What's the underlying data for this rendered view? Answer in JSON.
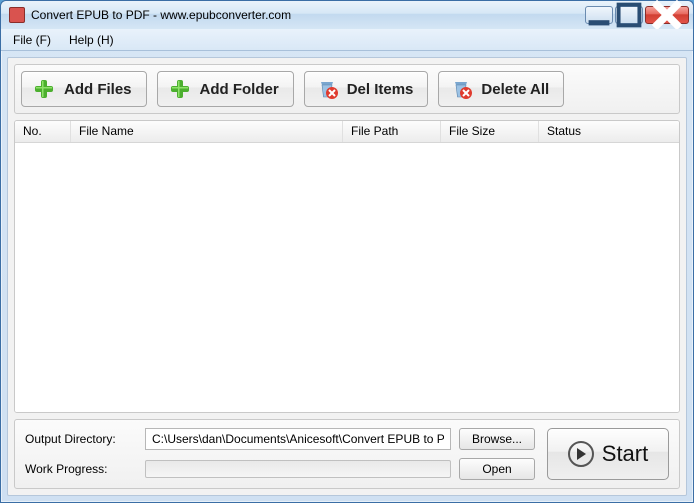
{
  "window": {
    "title": "Convert EPUB to PDF - www.epubconverter.com"
  },
  "menu": {
    "file": "File (F)",
    "help": "Help (H)"
  },
  "toolbar": {
    "add_files": "Add Files",
    "add_folder": "Add Folder",
    "del_items": "Del Items",
    "delete_all": "Delete All"
  },
  "columns": {
    "no": "No.",
    "file_name": "File Name",
    "file_path": "File Path",
    "file_size": "File Size",
    "status": "Status"
  },
  "rows": [],
  "output": {
    "label": "Output Directory:",
    "path": "C:\\Users\\dan\\Documents\\Anicesoft\\Convert EPUB to P",
    "browse": "Browse...",
    "open": "Open"
  },
  "progress": {
    "label": "Work Progress:"
  },
  "start": {
    "label": "Start"
  }
}
